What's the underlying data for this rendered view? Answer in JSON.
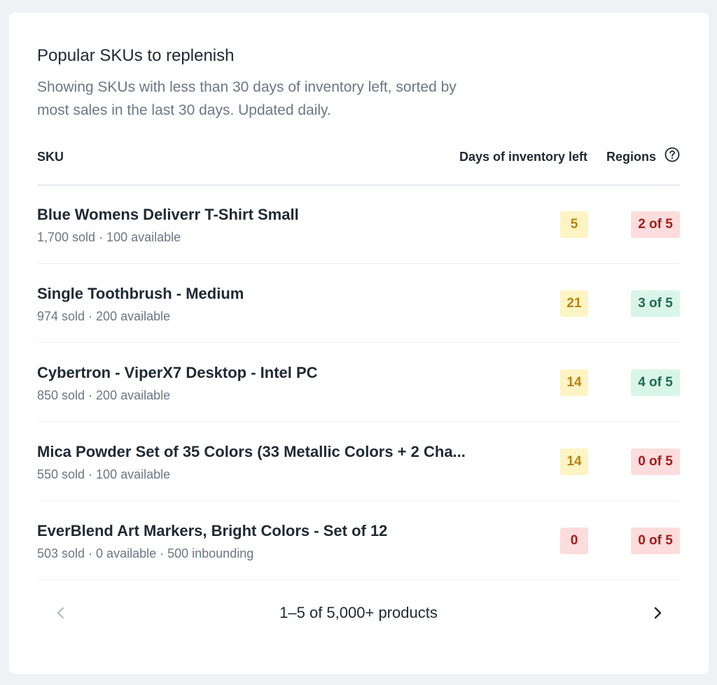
{
  "card": {
    "title": "Popular SKUs to replenish",
    "subtitle": "Showing SKUs with less than 30 days of inventory left, sorted by most sales in the last 30 days. Updated daily."
  },
  "table": {
    "columns": {
      "sku": "SKU",
      "days": "Days of inventory left",
      "regions": "Regions",
      "regions_help_icon": "question-circle-icon"
    },
    "rows": [
      {
        "name": "Blue Womens Deliverr T-Shirt Small",
        "meta": "1,700 sold · 100 available",
        "days": "5",
        "days_status": "warning",
        "regions": "2 of 5",
        "regions_status": "danger"
      },
      {
        "name": "Single Toothbrush - Medium",
        "meta": "974 sold · 200 available",
        "days": "21",
        "days_status": "warning",
        "regions": "3 of 5",
        "regions_status": "success"
      },
      {
        "name": "Cybertron - ViperX7 Desktop - Intel PC",
        "meta": "850 sold · 200 available",
        "days": "14",
        "days_status": "warning",
        "regions": "4 of 5",
        "regions_status": "success"
      },
      {
        "name": "Mica Powder Set of 35 Colors (33 Metallic Colors + 2 Cha...",
        "meta": "550 sold · 100 available",
        "days": "14",
        "days_status": "warning",
        "regions": "0 of 5",
        "regions_status": "danger"
      },
      {
        "name": "EverBlend Art Markers, Bright Colors - Set of 12",
        "meta": "503 sold · 0 available · 500 inbounding",
        "days": "0",
        "days_status": "danger",
        "regions": "0 of 5",
        "regions_status": "danger"
      }
    ]
  },
  "pagination": {
    "label": "1–5 of 5,000+ products",
    "prev_icon": "chevron-left-icon",
    "next_icon": "chevron-right-icon"
  },
  "colors": {
    "warning_bg": "#fdf4c4",
    "warning_text": "#b7830f",
    "danger_bg": "#fcdcdc",
    "danger_text": "#a11d1d",
    "success_bg": "#d9f5ea",
    "success_text": "#1f6b4f"
  }
}
